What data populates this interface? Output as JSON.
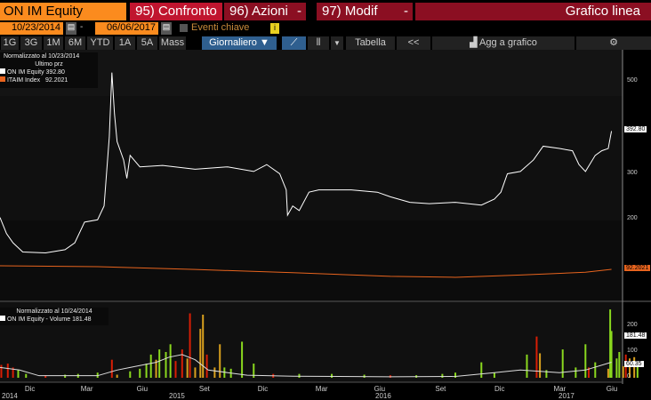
{
  "header": {
    "security": "ON IM Equity",
    "compare": "95) Confronto",
    "actions": "96) Azioni",
    "modify": "97) Modif",
    "chart_type": "Grafico linea",
    "dropdown_arrow": "-"
  },
  "dates": {
    "start": "10/23/2014",
    "sep": "-",
    "end": "06/06/2017",
    "events": "Eventi chiave",
    "info": "i"
  },
  "toolbar": {
    "periods": [
      "1G",
      "3G",
      "1M",
      "6M",
      "YTD",
      "1A",
      "5A",
      "Mass"
    ],
    "frequency": "Giornaliero ▼",
    "table": "Tabella",
    "back": "<<",
    "add": "Agg a grafico"
  },
  "legend": {
    "normalized": "Normalizzato al 10/23/2014",
    "last": "Ultimo prz",
    "series": [
      {
        "name": "ON IM Equity",
        "value": "392.80",
        "color": "#ffffff"
      },
      {
        "name": "ITAIM Index",
        "value": "92.2021",
        "color": "#e8641e"
      }
    ]
  },
  "volume_legend": {
    "normalized": "Normalizzato al 10/24/2014",
    "series": "ON IM Equity - Volume",
    "value": "181.48"
  },
  "chart_data": {
    "type": "line",
    "price_axis": {
      "ticks": [
        "500",
        "300",
        "200"
      ],
      "last_labels": [
        "392.80",
        "92.2021"
      ],
      "ylim": [
        50,
        560
      ]
    },
    "volume_axis": {
      "ticks": [
        "200",
        "100",
        "0"
      ],
      "last_labels": [
        "181.48",
        "60.35"
      ],
      "ylim": [
        0,
        280
      ]
    },
    "x_axis": {
      "months": [
        "Dic",
        "Mar",
        "Giu",
        "Set",
        "Dic",
        "Mar",
        "Giu",
        "Set",
        "Dic",
        "Mar",
        "Giu"
      ],
      "month_days": [
        49,
        135,
        221,
        317,
        407,
        496,
        586,
        680,
        771,
        862,
        943
      ],
      "years": [
        "2014",
        "2015",
        "2016",
        "2017"
      ],
      "year_days": [
        0,
        270,
        595,
        870
      ],
      "xlim": [
        0,
        957
      ]
    },
    "series": [
      {
        "name": "ON IM Equity",
        "color": "#ffffff",
        "points": [
          [
            0,
            205
          ],
          [
            10,
            170
          ],
          [
            20,
            150
          ],
          [
            35,
            130
          ],
          [
            70,
            128
          ],
          [
            100,
            135
          ],
          [
            115,
            150
          ],
          [
            130,
            195
          ],
          [
            150,
            200
          ],
          [
            160,
            230
          ],
          [
            168,
            380
          ],
          [
            172,
            520
          ],
          [
            176,
            430
          ],
          [
            180,
            370
          ],
          [
            190,
            330
          ],
          [
            195,
            290
          ],
          [
            200,
            340
          ],
          [
            215,
            315
          ],
          [
            250,
            318
          ],
          [
            300,
            310
          ],
          [
            350,
            315
          ],
          [
            390,
            305
          ],
          [
            410,
            320
          ],
          [
            430,
            300
          ],
          [
            440,
            265
          ],
          [
            442,
            210
          ],
          [
            450,
            230
          ],
          [
            460,
            220
          ],
          [
            475,
            260
          ],
          [
            490,
            265
          ],
          [
            540,
            265
          ],
          [
            580,
            260
          ],
          [
            600,
            250
          ],
          [
            630,
            238
          ],
          [
            660,
            235
          ],
          [
            700,
            238
          ],
          [
            740,
            232
          ],
          [
            760,
            245
          ],
          [
            770,
            260
          ],
          [
            780,
            300
          ],
          [
            800,
            305
          ],
          [
            820,
            330
          ],
          [
            835,
            360
          ],
          [
            860,
            355
          ],
          [
            880,
            350
          ],
          [
            890,
            320
          ],
          [
            900,
            305
          ],
          [
            915,
            340
          ],
          [
            925,
            350
          ],
          [
            935,
            355
          ],
          [
            940,
            392.8
          ]
        ]
      },
      {
        "name": "ITAIM Index",
        "color": "#e8641e",
        "points": [
          [
            0,
            100
          ],
          [
            150,
            98
          ],
          [
            300,
            92
          ],
          [
            450,
            85
          ],
          [
            600,
            77
          ],
          [
            700,
            75
          ],
          [
            800,
            80
          ],
          [
            900,
            86
          ],
          [
            940,
            92.2
          ]
        ]
      },
      {
        "name": "Volume MA",
        "color": "#dddddd",
        "points": [
          [
            0,
            40
          ],
          [
            30,
            30
          ],
          [
            60,
            8
          ],
          [
            150,
            8
          ],
          [
            180,
            30
          ],
          [
            200,
            40
          ],
          [
            220,
            50
          ],
          [
            240,
            60
          ],
          [
            260,
            80
          ],
          [
            280,
            90
          ],
          [
            300,
            70
          ],
          [
            320,
            30
          ],
          [
            350,
            20
          ],
          [
            380,
            10
          ],
          [
            450,
            6
          ],
          [
            600,
            4
          ],
          [
            700,
            5
          ],
          [
            760,
            20
          ],
          [
            800,
            30
          ],
          [
            860,
            20
          ],
          [
            900,
            30
          ],
          [
            940,
            60.35
          ]
        ]
      }
    ],
    "volume_bars": [
      [
        2,
        50,
        "r"
      ],
      [
        12,
        55,
        "r"
      ],
      [
        20,
        40,
        "r"
      ],
      [
        28,
        30,
        "g"
      ],
      [
        40,
        15,
        "g"
      ],
      [
        70,
        10,
        "r"
      ],
      [
        100,
        12,
        "g"
      ],
      [
        120,
        15,
        "g"
      ],
      [
        150,
        20,
        "g"
      ],
      [
        172,
        70,
        "r"
      ],
      [
        180,
        12,
        "y"
      ],
      [
        200,
        25,
        "g"
      ],
      [
        215,
        35,
        "g"
      ],
      [
        225,
        55,
        "g"
      ],
      [
        232,
        90,
        "g"
      ],
      [
        240,
        70,
        "y"
      ],
      [
        245,
        110,
        "g"
      ],
      [
        255,
        100,
        "g"
      ],
      [
        262,
        130,
        "g"
      ],
      [
        270,
        65,
        "r"
      ],
      [
        280,
        110,
        "r"
      ],
      [
        288,
        75,
        "y"
      ],
      [
        292,
        250,
        "r"
      ],
      [
        300,
        40,
        "y"
      ],
      [
        308,
        190,
        "y"
      ],
      [
        312,
        245,
        "y"
      ],
      [
        318,
        90,
        "r"
      ],
      [
        330,
        40,
        "y"
      ],
      [
        338,
        130,
        "y"
      ],
      [
        345,
        40,
        "g"
      ],
      [
        355,
        35,
        "g"
      ],
      [
        372,
        140,
        "g"
      ],
      [
        390,
        55,
        "g"
      ],
      [
        420,
        15,
        "r"
      ],
      [
        460,
        15,
        "g"
      ],
      [
        510,
        15,
        "g"
      ],
      [
        560,
        12,
        "g"
      ],
      [
        600,
        10,
        "r"
      ],
      [
        640,
        10,
        "g"
      ],
      [
        680,
        15,
        "g"
      ],
      [
        700,
        20,
        "g"
      ],
      [
        740,
        60,
        "g"
      ],
      [
        760,
        20,
        "g"
      ],
      [
        810,
        90,
        "g"
      ],
      [
        825,
        160,
        "r"
      ],
      [
        830,
        95,
        "y"
      ],
      [
        840,
        30,
        "g"
      ],
      [
        865,
        110,
        "g"
      ],
      [
        885,
        40,
        "g"
      ],
      [
        900,
        130,
        "g"
      ],
      [
        905,
        40,
        "r"
      ],
      [
        915,
        60,
        "g"
      ],
      [
        935,
        35,
        "y"
      ],
      [
        948,
        75,
        "g"
      ],
      [
        952,
        100,
        "g"
      ],
      [
        958,
        45,
        "y"
      ],
      [
        962,
        90,
        "r"
      ],
      [
        968,
        75,
        "y"
      ],
      [
        975,
        80,
        "y"
      ],
      [
        980,
        60,
        "g"
      ],
      [
        938,
        265,
        "g"
      ],
      [
        940,
        181.48,
        "g"
      ]
    ]
  }
}
